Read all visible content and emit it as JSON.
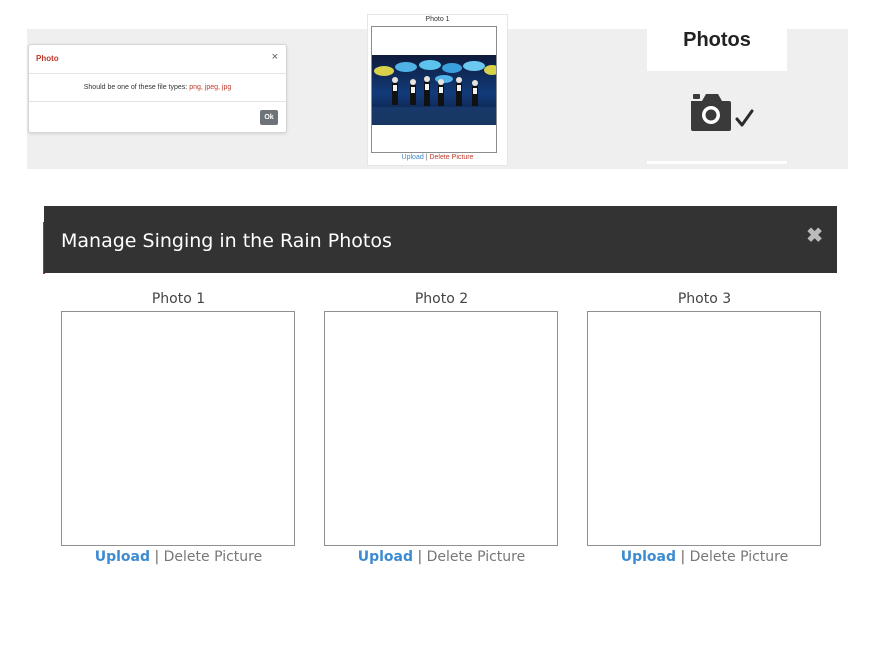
{
  "dialog": {
    "title": "Photo",
    "message": "Should be one of these file types:",
    "types": "png, jpeg, jpg",
    "close": "×",
    "ok_label": "Ok"
  },
  "mini_card": {
    "label": "Photo 1",
    "upload": "Upload",
    "separator": "|",
    "delete": "Delete Picture"
  },
  "photos_tile": {
    "title": "Photos",
    "icon": "camera-check-icon"
  },
  "manage": {
    "title": "Manage Singing in the Rain Photos",
    "close": "✖",
    "slots": [
      {
        "label": "Photo 1",
        "upload": "Upload",
        "separator": "|",
        "delete": "Delete Picture"
      },
      {
        "label": "Photo 2",
        "upload": "Upload",
        "separator": "|",
        "delete": "Delete Picture"
      },
      {
        "label": "Photo 3",
        "upload": "Upload",
        "separator": "|",
        "delete": "Delete Picture"
      }
    ]
  },
  "colors": {
    "header_bg": "#333333",
    "link_blue": "#3d8bd0",
    "error_red": "#c0392b"
  }
}
